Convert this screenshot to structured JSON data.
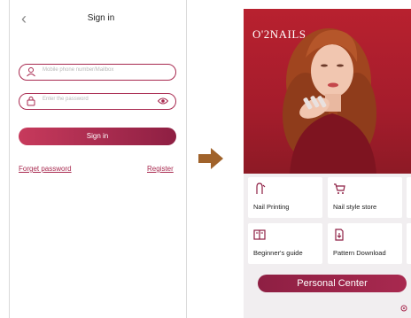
{
  "signin": {
    "title": "Sign in",
    "phone_placeholder": "Mobile phone number/Mailbox",
    "password_placeholder": "Enter the password",
    "submit_label": "Sign in",
    "forget_label": "Forget password",
    "register_label": "Register"
  },
  "home": {
    "brand": "O'2NAILS",
    "cards": [
      {
        "label": "Nail Printing",
        "icon": "nail-icon"
      },
      {
        "label": "Nail style store",
        "icon": "cart-icon"
      },
      {
        "label": "Beginner's guide",
        "icon": "book-icon"
      },
      {
        "label": "Pattern Download",
        "icon": "download-icon"
      }
    ],
    "personal_center_label": "Personal Center"
  },
  "colors": {
    "accent": "#a8294f",
    "hero": "#b8212f",
    "arrow": "#a0622a"
  }
}
